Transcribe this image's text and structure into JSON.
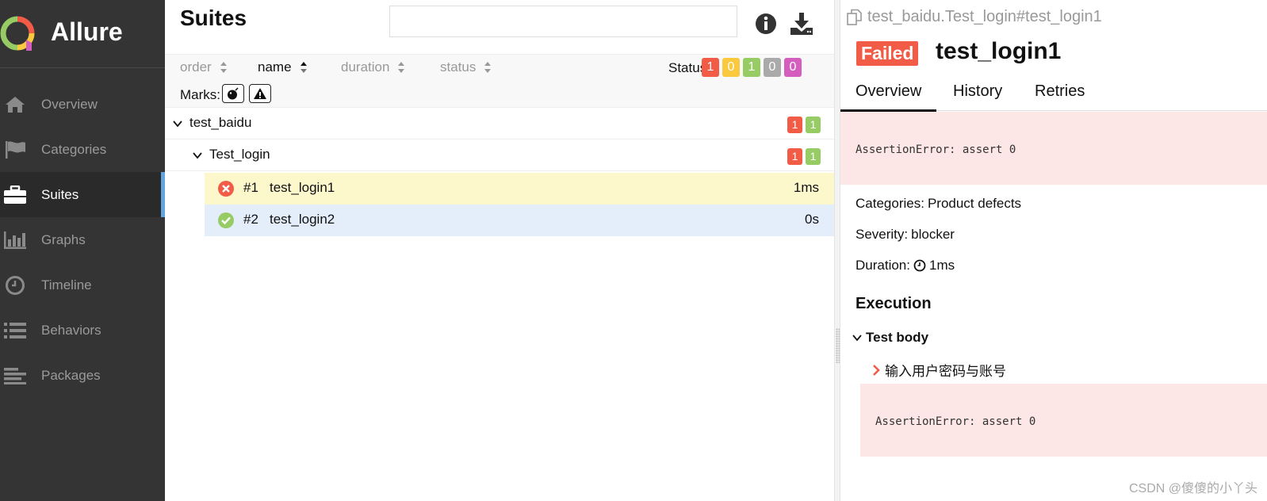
{
  "sidebar": {
    "brand": "Allure",
    "items": [
      {
        "label": "Overview",
        "icon": "home-icon"
      },
      {
        "label": "Categories",
        "icon": "flag-icon"
      },
      {
        "label": "Suites",
        "icon": "briefcase-icon",
        "active": true
      },
      {
        "label": "Graphs",
        "icon": "bar-chart-icon"
      },
      {
        "label": "Timeline",
        "icon": "clock-icon"
      },
      {
        "label": "Behaviors",
        "icon": "list-icon"
      },
      {
        "label": "Packages",
        "icon": "align-left-icon"
      }
    ]
  },
  "suites": {
    "title": "Suites",
    "search_placeholder": "",
    "sorters": [
      "order",
      "name",
      "duration",
      "status"
    ],
    "active_sorter": "name",
    "status_label": "Status:",
    "status_counts": [
      {
        "value": "1",
        "color": "#f25c47"
      },
      {
        "value": "0",
        "color": "#fbc93e"
      },
      {
        "value": "1",
        "color": "#97cc64"
      },
      {
        "value": "0",
        "color": "#aaaaaa"
      },
      {
        "value": "0",
        "color": "#d35ebe"
      }
    ],
    "marks_label": "Marks:",
    "tree": {
      "suite": {
        "name": "test_baidu",
        "failed": "1",
        "passed": "1"
      },
      "class": {
        "name": "Test_login",
        "failed": "1",
        "passed": "1"
      },
      "tests": [
        {
          "num": "#1",
          "name": "test_login1",
          "duration": "1ms",
          "status": "failed"
        },
        {
          "num": "#2",
          "name": "test_login2",
          "duration": "0s",
          "status": "passed"
        }
      ]
    }
  },
  "detail": {
    "breadcrumb": "test_baidu.Test_login#test_login1",
    "status": "Failed",
    "title": "test_login1",
    "tabs": [
      "Overview",
      "History",
      "Retries"
    ],
    "error": "AssertionError: assert 0",
    "categories_label": "Categories:",
    "categories_value": "Product defects",
    "severity_label": "Severity:",
    "severity_value": "blocker",
    "duration_label": "Duration:",
    "duration_value": "1ms",
    "execution_title": "Execution",
    "test_body_label": "Test body",
    "step_label": "输入用户密码与账号",
    "step_error": "AssertionError: assert 0"
  },
  "watermark": "CSDN @傻傻的小丫头",
  "colors": {
    "failed": "#f25c47",
    "passed": "#97cc64",
    "accent": "#62a4dd"
  }
}
